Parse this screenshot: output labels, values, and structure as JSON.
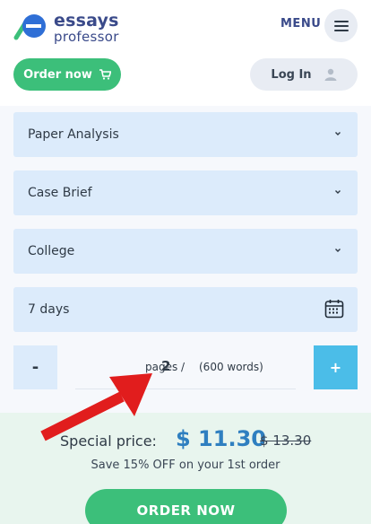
{
  "header": {
    "logo_line1": "essays",
    "logo_line2": "professor",
    "menu_label": "MENU",
    "order_now_label": "Order now",
    "login_label": "Log In"
  },
  "form": {
    "paper_type": "Paper Analysis",
    "assignment_type": "Case Brief",
    "academic_level": "College",
    "deadline": "7 days",
    "pages": {
      "minus_label": "-",
      "plus_label": "+",
      "value": "2",
      "unit_label": "pages /",
      "words_label": "(600 words)"
    }
  },
  "pricing": {
    "special_label": "Special price:",
    "price": "$ 11.30",
    "old_price": "$ 13.30",
    "save_text": "Save 15% OFF on your 1st order",
    "cta_label": "ORDER NOW"
  },
  "colors": {
    "brand_green": "#3cbf7a",
    "field_blue": "#dcebfb",
    "plus_blue": "#4bbde8",
    "price_blue": "#2f7fc0",
    "arrow_red": "#e11d1d"
  }
}
